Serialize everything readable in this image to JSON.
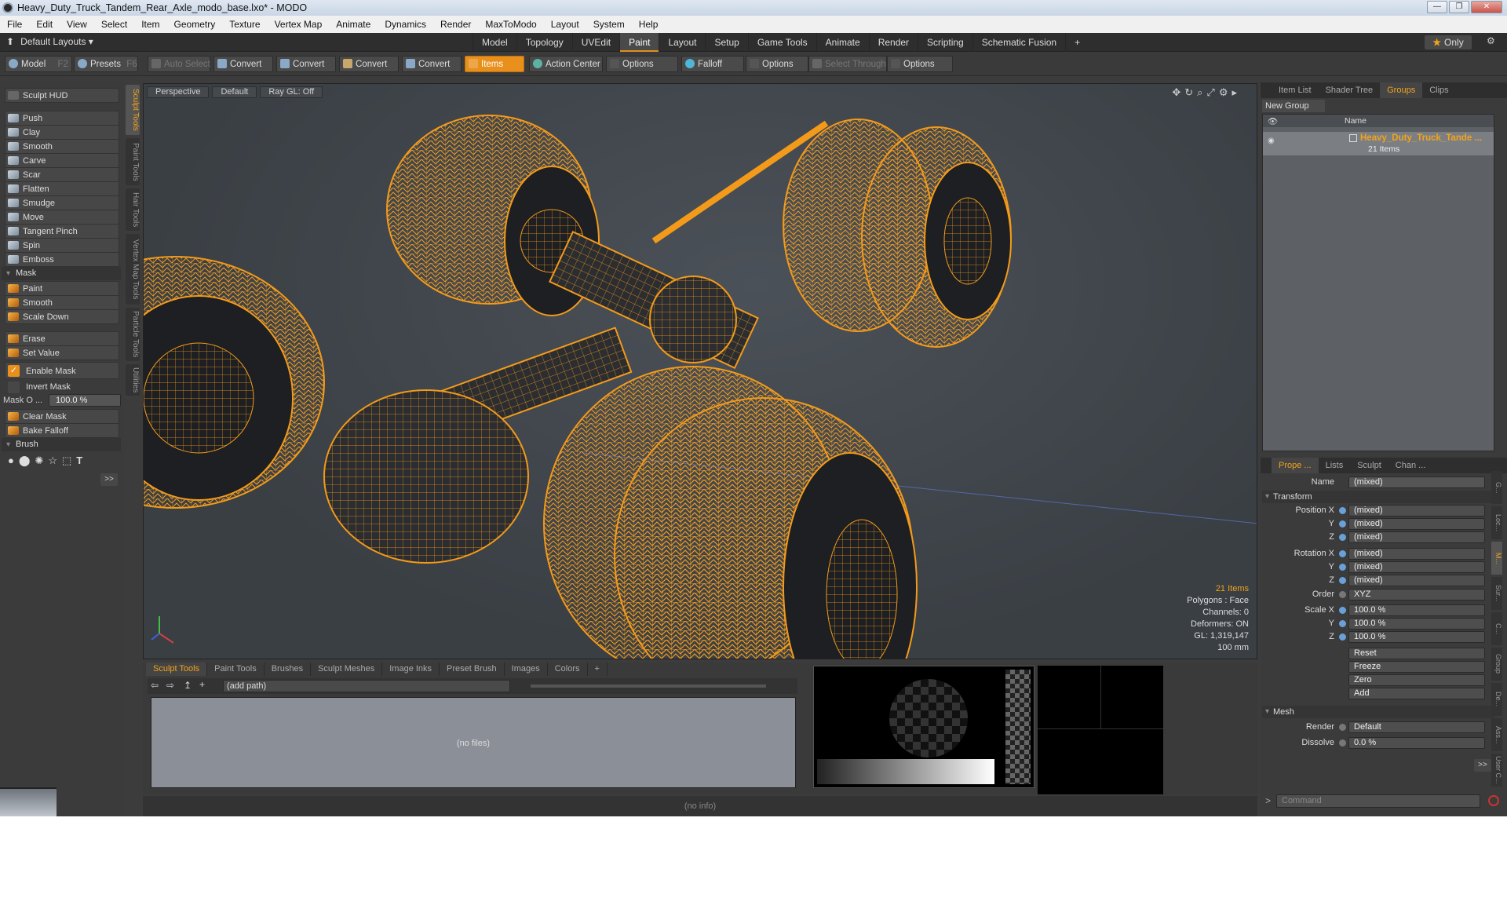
{
  "window": {
    "title": "Heavy_Duty_Truck_Tandem_Rear_Axle_modo_base.lxo* - MODO"
  },
  "menu": [
    "File",
    "Edit",
    "View",
    "Select",
    "Item",
    "Geometry",
    "Texture",
    "Vertex Map",
    "Animate",
    "Dynamics",
    "Render",
    "MaxToModo",
    "Layout",
    "System",
    "Help"
  ],
  "layout": {
    "default_layouts": "Default Layouts ▾",
    "tabs": [
      "Model",
      "Topology",
      "UVEdit",
      "Paint",
      "Layout",
      "Setup",
      "Game Tools",
      "Animate",
      "Render",
      "Scripting",
      "Schematic Fusion"
    ],
    "active_tab": "Paint",
    "only_label": "Only"
  },
  "toolbar": {
    "model": "Model",
    "model_key": "F2",
    "presets": "Presets",
    "presets_key": "F6",
    "auto_select": "Auto Select",
    "convert": "Convert",
    "items": "Items",
    "action_center": "Action Center",
    "options": "Options",
    "falloff": "Falloff",
    "select_through": "Select Through"
  },
  "left": {
    "sculpt_hud": "Sculpt HUD",
    "tools": [
      "Push",
      "Clay",
      "Smooth",
      "Carve",
      "Scar",
      "Flatten",
      "Smudge",
      "Move",
      "Tangent Pinch",
      "Spin",
      "Emboss"
    ],
    "mask_section": "Mask",
    "mask_tools": [
      "Paint",
      "Smooth",
      "Scale Down"
    ],
    "erase": "Erase",
    "set_value": "Set Value",
    "enable_mask": "Enable Mask",
    "invert_mask": "Invert Mask",
    "mask_opacity_label": "Mask O ...",
    "mask_opacity_value": "100.0 %",
    "clear_mask": "Clear Mask",
    "bake_falloff": "Bake Falloff",
    "brush_section": "Brush",
    "more": ">>"
  },
  "vtabs": [
    "Sculpt Tools",
    "Paint Tools",
    "Hair Tools",
    "Vertex Map Tools",
    "Particle Tools",
    "Utilities"
  ],
  "viewport": {
    "view": "Perspective",
    "shading": "Default",
    "raygl": "Ray GL: Off",
    "info": {
      "items": "21 Items",
      "polygons": "Polygons : Face",
      "channels": "Channels: 0",
      "deformers": "Deformers: ON",
      "gl": "GL: 1,319,147",
      "scale": "100 mm"
    },
    "wire_color": "#f39a1a"
  },
  "bottom": {
    "tabs": [
      "Sculpt Tools",
      "Paint Tools",
      "Brushes",
      "Sculpt Meshes",
      "Image Inks",
      "Preset Brush",
      "Images",
      "Colors"
    ],
    "path": "(add path)",
    "no_files": "(no files)",
    "status": "(no info)"
  },
  "right": {
    "tabs": [
      "Item List",
      "Shader Tree",
      "Groups",
      "Clips"
    ],
    "active_tab": "Groups",
    "new_group": "New Group",
    "name_header": "Name",
    "group_name": "Heavy_Duty_Truck_Tande ...",
    "group_count": "21 Items",
    "prop_tabs": [
      "Prope ...",
      "Lists",
      "Sculpt",
      "Chan ..."
    ],
    "name_label": "Name",
    "name_value": "(mixed)",
    "transform": "Transform",
    "position_x": "Position X",
    "rotation_x": "Rotation X",
    "scale_x": "Scale X",
    "y": "Y",
    "z": "Z",
    "mixed": "(mixed)",
    "order_label": "Order",
    "order_value": "XYZ",
    "scale_value": "100.0 %",
    "reset": "Reset",
    "freeze": "Freeze",
    "zero": "Zero",
    "add": "Add",
    "mesh": "Mesh",
    "render_label": "Render",
    "render_value": "Default",
    "dissolve_label": "Dissolve",
    "dissolve_value": "0.0 %",
    "more": ">>",
    "command": "Command"
  }
}
